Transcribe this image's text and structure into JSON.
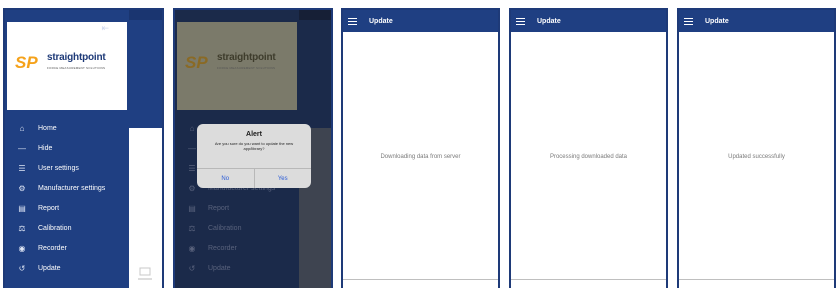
{
  "drawer": {
    "logo": {
      "text": "straightpoint",
      "tagline": "FORCE MEASUREMENT SOLUTIONS",
      "mark": "SP"
    },
    "items": [
      {
        "icon": "home-icon",
        "glyph": "⌂",
        "label": "Home"
      },
      {
        "icon": "minus-icon",
        "glyph": "—",
        "label": "Hide"
      },
      {
        "icon": "user-icon",
        "glyph": "☰",
        "label": "User settings"
      },
      {
        "icon": "gear-icon",
        "glyph": "⚙",
        "label": "Manufacturer settings"
      },
      {
        "icon": "report-icon",
        "glyph": "▤",
        "label": "Report"
      },
      {
        "icon": "calibration-icon",
        "glyph": "⚖",
        "label": "Calibration"
      },
      {
        "icon": "recorder-icon",
        "glyph": "◉",
        "label": "Recorder"
      },
      {
        "icon": "update-icon",
        "glyph": "↺",
        "label": "Update"
      }
    ]
  },
  "alert": {
    "title": "Alert",
    "message": "Are you sure do you want to update the new app/library?",
    "no_label": "No",
    "yes_label": "Yes"
  },
  "update_screens": [
    {
      "title": "Update",
      "message": "Downloading data from server"
    },
    {
      "title": "Update",
      "message": "Processing downloaded data"
    },
    {
      "title": "Update",
      "message": "Updated successfully"
    }
  ],
  "colors": {
    "brand_blue": "#1f3f82",
    "logo_orange": "#f5a21b"
  }
}
